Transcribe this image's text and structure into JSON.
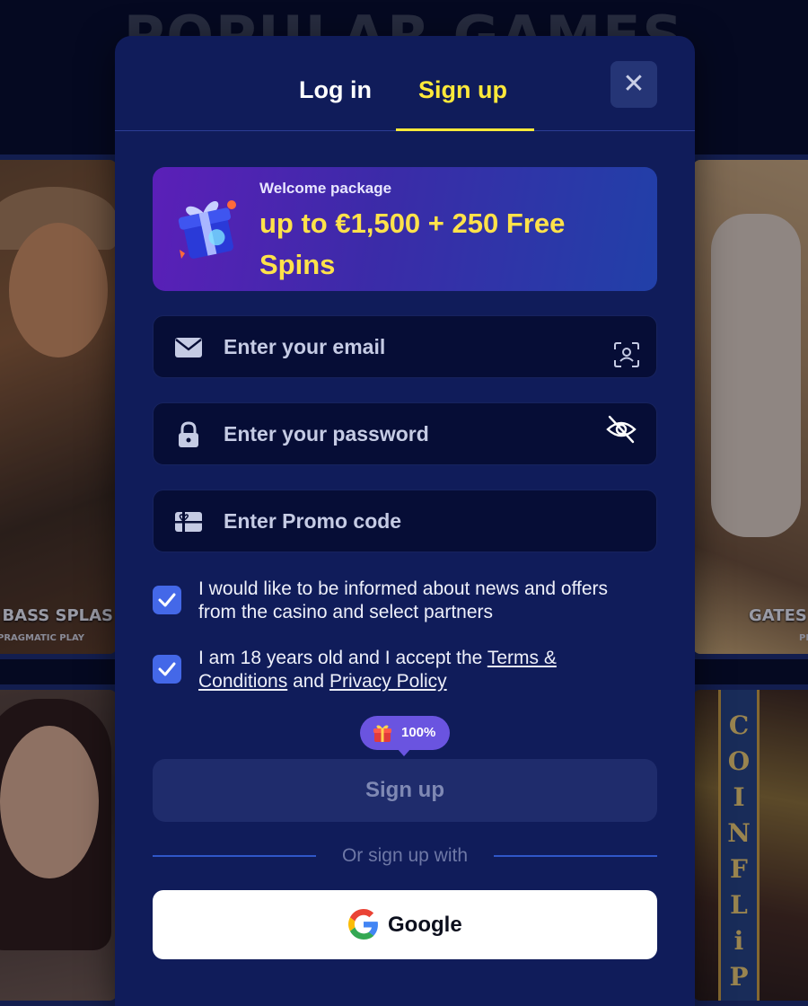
{
  "background": {
    "section_title": "POPULAR GAMES",
    "games": [
      {
        "name": "BASS SPLAS",
        "provider": "PRAGMATIC PLAY"
      },
      {
        "name": "GATES",
        "provider": "PR"
      }
    ],
    "coin_letters": [
      "C",
      "O",
      "I",
      "N",
      "F",
      "L",
      "i",
      "P"
    ]
  },
  "modal": {
    "tabs": [
      {
        "label": "Log in",
        "active": false
      },
      {
        "label": "Sign up",
        "active": true
      }
    ],
    "close_icon": "close-icon",
    "banner": {
      "small": "Welcome package",
      "big": "up to €1,500 + 250 Free Spins"
    },
    "fields": {
      "email": {
        "placeholder": "Enter your email",
        "value": ""
      },
      "password": {
        "placeholder": "Enter your password",
        "value": ""
      },
      "promo": {
        "placeholder": "Enter Promo code",
        "value": ""
      }
    },
    "checkboxes": {
      "news": {
        "checked": true,
        "label": "I would like to be informed about news and offers from the casino and select partners"
      },
      "terms": {
        "checked": true,
        "prefix": "I am 18 years old and I accept the ",
        "terms_link": "Terms & Conditions",
        "middle": " and ",
        "privacy_link": "Privacy Policy"
      }
    },
    "bonus_badge": "100%",
    "submit_label": "Sign up",
    "divider_text": "Or sign up with",
    "google_label": "Google"
  },
  "colors": {
    "modal_bg": "#101c5a",
    "accent_yellow": "#ffe93a",
    "checkbox_blue": "#4468e8",
    "badge_purple": "#6a54e0"
  }
}
